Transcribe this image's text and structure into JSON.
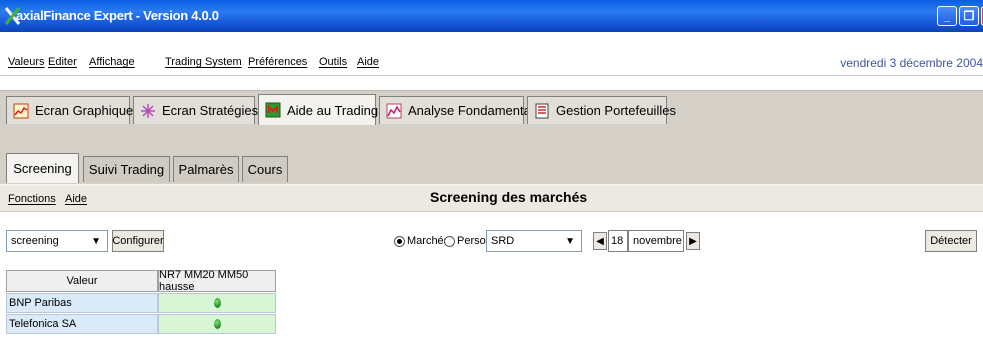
{
  "window": {
    "title": "axialFinance Expert - Version 4.0.0"
  },
  "menubar": {
    "items": [
      "Valeurs",
      "Editer",
      "Affichage",
      "Trading System",
      "Préférences",
      "Outils",
      "Aide"
    ],
    "date": "vendredi 3 décembre 2004"
  },
  "main_tabs": [
    {
      "label": "Ecran Graphiques",
      "icon": "chart-icon"
    },
    {
      "label": "Ecran Stratégies",
      "icon": "strategy-icon"
    },
    {
      "label": "Aide au Trading",
      "icon": "trading-aid-icon",
      "active": true
    },
    {
      "label": "Analyse Fondamentale",
      "icon": "fundamental-icon"
    },
    {
      "label": "Gestion Portefeuilles",
      "icon": "portfolio-icon"
    }
  ],
  "sub_tabs": [
    {
      "label": "Screening",
      "active": true
    },
    {
      "label": "Suivi Trading"
    },
    {
      "label": "Palmarès"
    },
    {
      "label": "Cours"
    }
  ],
  "function_bar": {
    "menus": [
      "Fonctions",
      "Aide"
    ],
    "title": "Screening des marchés"
  },
  "toolbar": {
    "screening_select": "screening",
    "configure_label": "Configurer",
    "radio_marches": "Marchés",
    "radio_perso": "Perso.",
    "radio_selected": "Marchés",
    "market_select": "SRD",
    "day": "18",
    "month": "novembre",
    "detect_label": "Détecter"
  },
  "table": {
    "headers": [
      "Valeur",
      "NR7 MM20 MM50 hausse"
    ],
    "rows": [
      {
        "name": "BNP Paribas",
        "signal": "green-dot"
      },
      {
        "name": "Telefonica SA",
        "signal": "green-dot"
      }
    ]
  },
  "colors": {
    "title_bar": "#1656d6",
    "date_text": "#3d56a8",
    "name_cell": "#dbeaf8",
    "signal_cell": "#d8f6d6",
    "signal_dot": "#1e8c1e"
  }
}
